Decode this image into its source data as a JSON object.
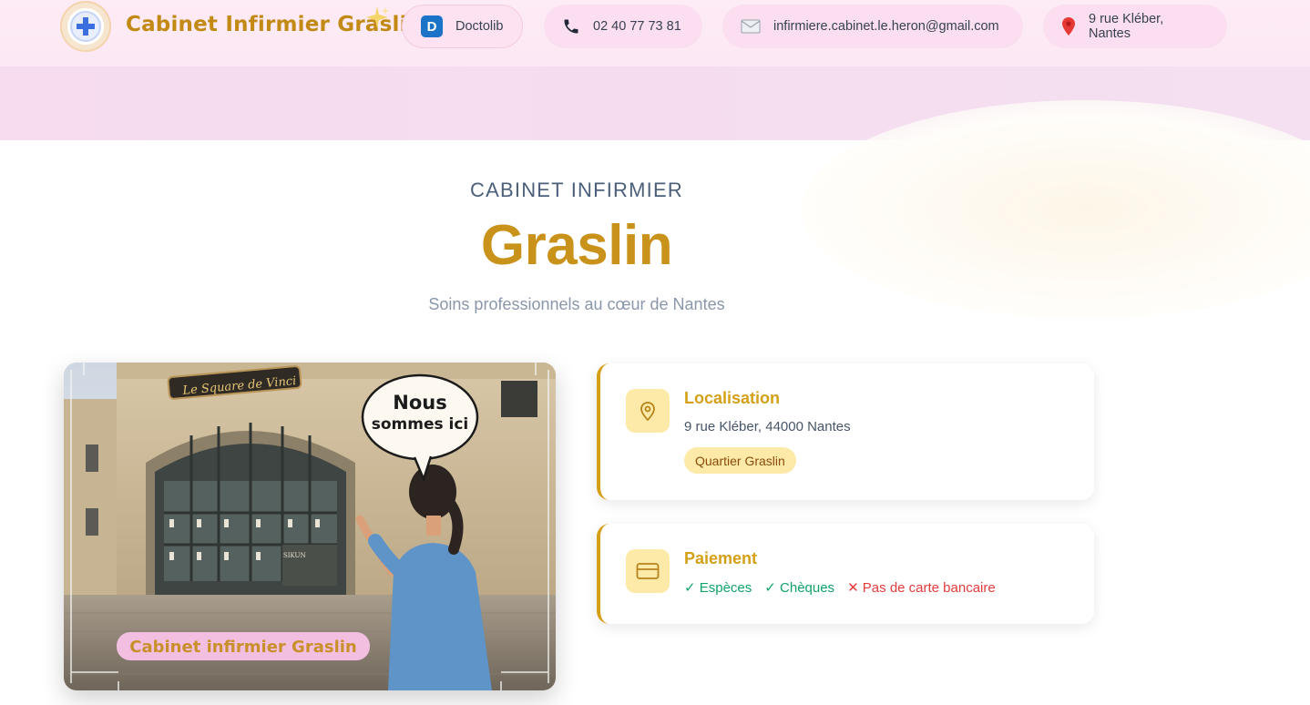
{
  "header": {
    "brand": "Cabinet Infirmier Graslin",
    "doctolib": {
      "badge": "D",
      "label": "Doctolib"
    },
    "phone": "02 40 77 73 81",
    "email": "infirmiere.cabinet.le.heron@gmail.com",
    "address": "9 rue Kléber, Nantes"
  },
  "hero": {
    "eyebrow": "CABINET INFIRMIER",
    "title": "Graslin",
    "tagline": "Soins professionnels au cœur de Nantes"
  },
  "photo": {
    "sign": "Le Square de Vinci",
    "bubble": [
      "Nous",
      "sommes ici"
    ],
    "caption": "Cabinet infirmier Graslin",
    "shop": "SIKUN"
  },
  "location_card": {
    "title": "Localisation",
    "address": "9 rue Kléber, 44000 Nantes",
    "tag": "Quartier Graslin"
  },
  "payment_card": {
    "title": "Paiement",
    "options": [
      {
        "label": "✓ Espèces",
        "accepted": true
      },
      {
        "label": "✓ Chèques",
        "accepted": true
      },
      {
        "label": "✕ Pas de carte bancaire",
        "accepted": false
      }
    ]
  },
  "colors": {
    "accent": "#d4a017",
    "brand": "#c28a14",
    "pink": "#fce8f4",
    "ok": "#10a36a",
    "no": "#e23c3c"
  },
  "icons": [
    "medical-cross-icon",
    "sparkle-icon",
    "phone-icon",
    "mail-icon",
    "pin-icon",
    "location-icon",
    "credit-card-icon"
  ]
}
